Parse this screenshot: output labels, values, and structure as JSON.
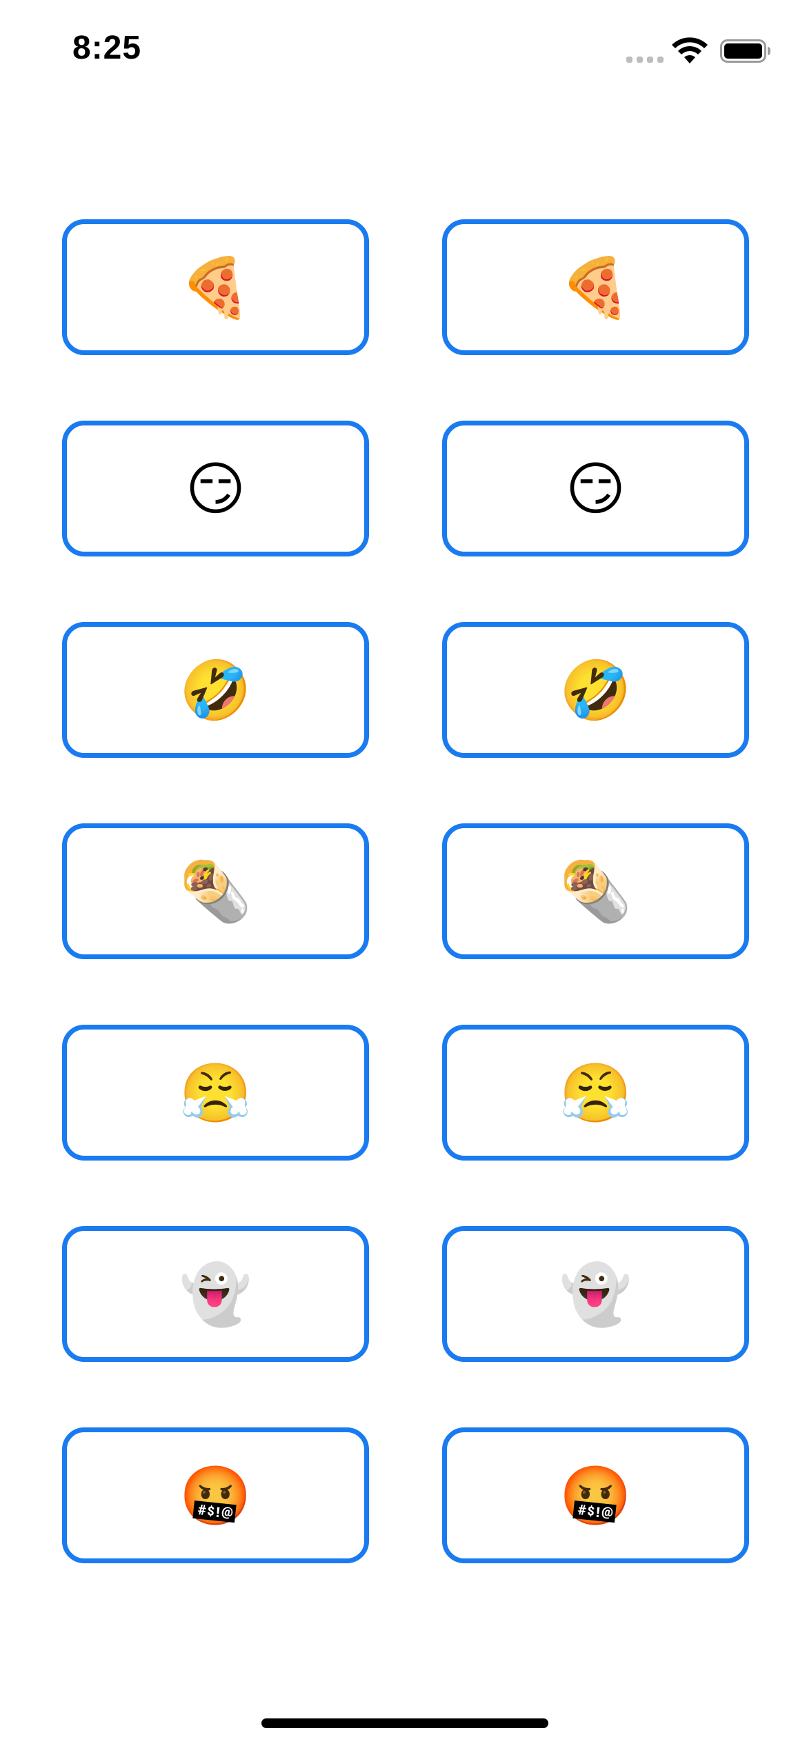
{
  "status_bar": {
    "time": "8:25"
  },
  "rows": [
    {
      "left": {
        "emoji": "🍕",
        "icon": "pizza-icon"
      },
      "right": {
        "emoji": "🍕",
        "icon": "pizza-icon"
      }
    },
    {
      "left": {
        "emoji": "😏",
        "icon": "smirk-icon"
      },
      "right": {
        "emoji": "😏",
        "icon": "smirk-icon"
      }
    },
    {
      "left": {
        "emoji": "🤣",
        "icon": "rolling-laughing-icon"
      },
      "right": {
        "emoji": "🤣",
        "icon": "rolling-laughing-icon"
      }
    },
    {
      "left": {
        "emoji": "🌯",
        "icon": "burrito-icon"
      },
      "right": {
        "emoji": "🌯",
        "icon": "burrito-icon"
      }
    },
    {
      "left": {
        "emoji": "😤",
        "icon": "huffing-face-icon"
      },
      "right": {
        "emoji": "😤",
        "icon": "huffing-face-icon"
      }
    },
    {
      "left": {
        "emoji": "👻",
        "icon": "ghost-icon"
      },
      "right": {
        "emoji": "👻",
        "icon": "ghost-icon"
      }
    },
    {
      "left": {
        "emoji": "🤬",
        "icon": "cursing-face-icon"
      },
      "right": {
        "emoji": "🤬",
        "icon": "cursing-face-icon"
      }
    }
  ],
  "colors": {
    "button_border": "#1a7bf0",
    "background": "#ffffff"
  }
}
